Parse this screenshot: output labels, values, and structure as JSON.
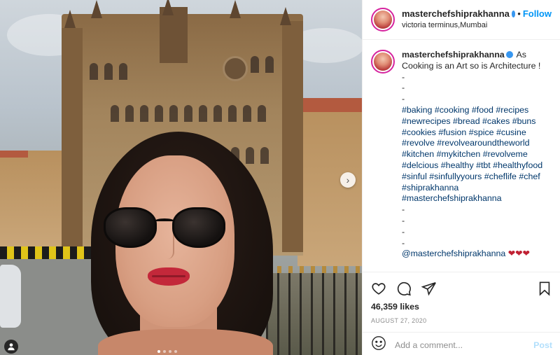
{
  "post": {
    "username": "masterchefshiprakhanna",
    "follow_label": "Follow",
    "separator": "•",
    "location": "victoria terminus,Mumbai",
    "caption": {
      "first_line": "As",
      "lines": [
        "Cooking is an Art so is Architecture !",
        "-",
        "-",
        "-",
        "#baking #cooking #food #recipes",
        "#newrecipes #bread #cakes #buns",
        "#cookies #fusion #spice #cusine",
        "#revolve #revolvearoundtheworld",
        "#kitchen #mykitchen #revolveme",
        "#delcious #healthy #tbt #healthyfood",
        "#sinful #sinfullyyours #cheflife #chef",
        "#shiprakhanna",
        "#masterchefshiprakhanna",
        "-",
        "-",
        "-",
        "-"
      ],
      "mention": "@masterchefshiprakhanna",
      "hearts": "❤❤❤"
    },
    "likes": "46,359 likes",
    "date": "AUGUST 27, 2020",
    "comment_placeholder": "Add a comment...",
    "post_label": "Post",
    "carousel": {
      "total": 4,
      "active": 1
    }
  },
  "icons": {
    "like": "heart-icon",
    "comment": "comment-icon",
    "share": "share-icon",
    "save": "bookmark-icon",
    "emoji": "emoji-icon",
    "next": "chevron-right-icon",
    "tagged_user": "user-icon"
  },
  "colors": {
    "accent": "#0095f6",
    "verified": "#3897f0",
    "link": "#00376b",
    "muted": "#8e8e8e",
    "post_disabled": "#b2dffc"
  }
}
